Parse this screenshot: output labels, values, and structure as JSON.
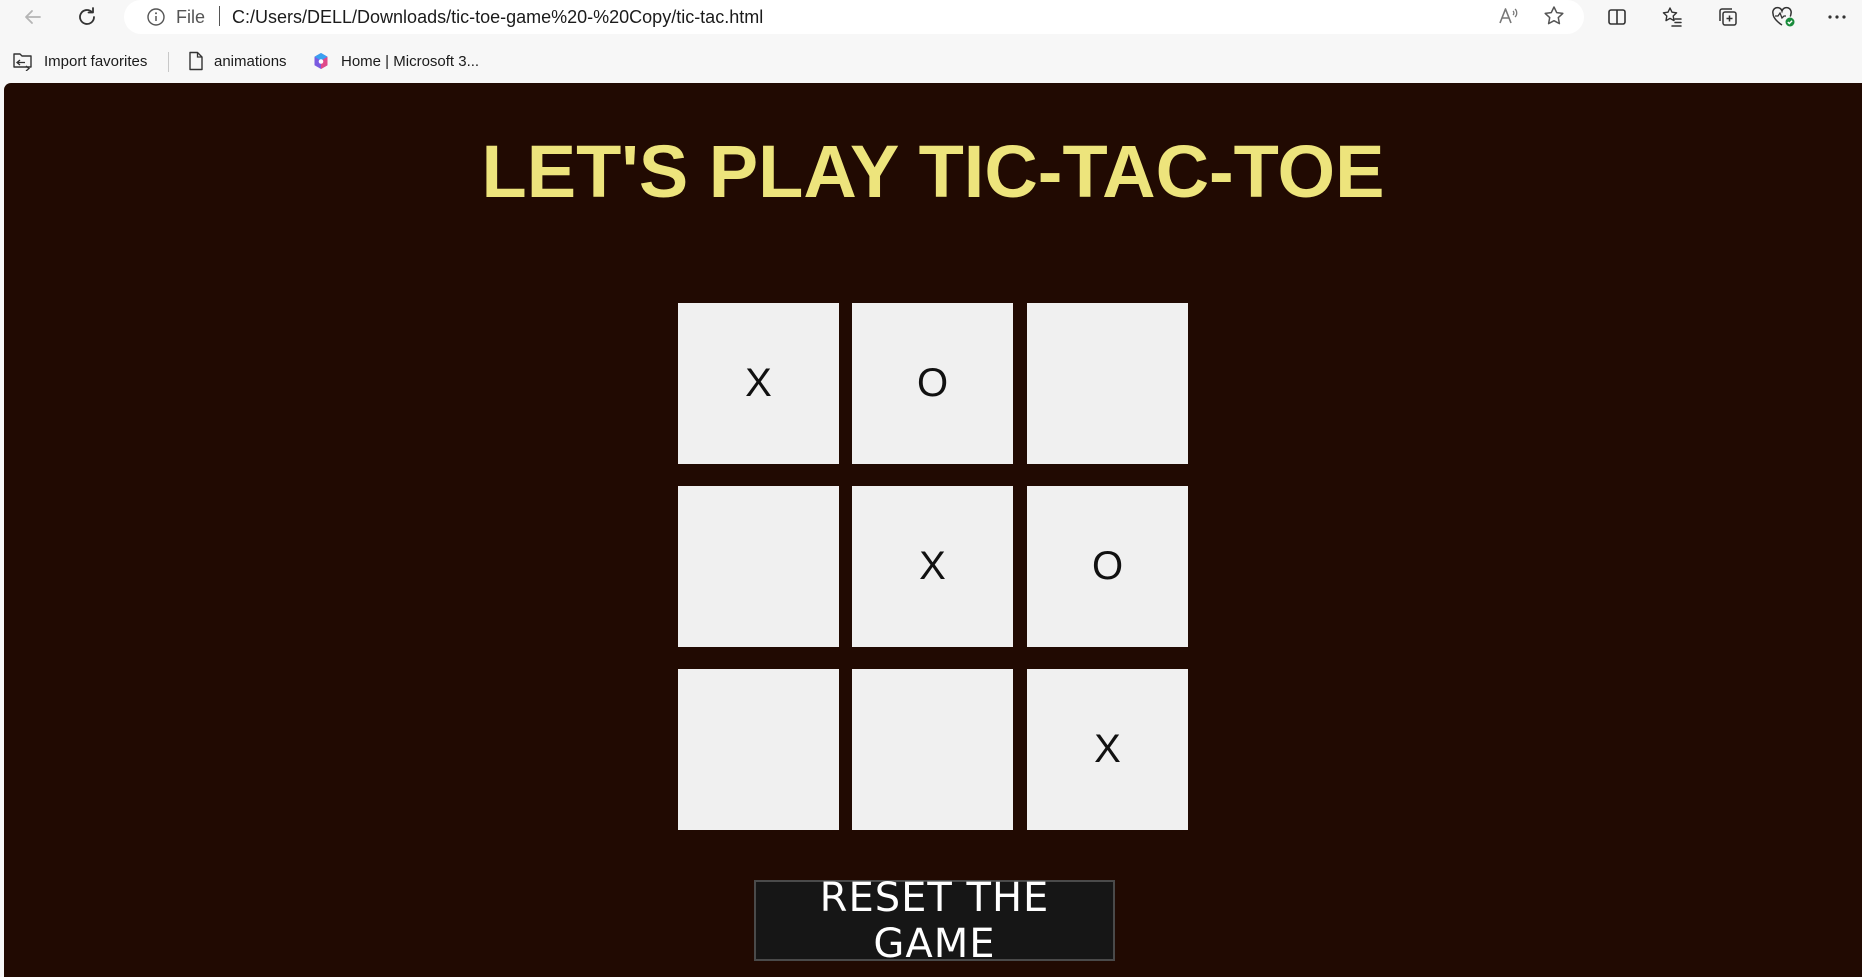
{
  "browser": {
    "address": {
      "scheme_label": "File",
      "url": "C:/Users/DELL/Downloads/tic-toe-game%20-%20Copy/tic-tac.html"
    },
    "favorites": [
      {
        "label": "Import favorites",
        "icon": "import-favorites-icon"
      },
      {
        "label": "animations",
        "icon": "page-icon"
      },
      {
        "label": "Home | Microsoft 3...",
        "icon": "microsoft365-icon"
      }
    ]
  },
  "page": {
    "title": "LET'S PLAY TIC-TAC-TOE",
    "board": [
      [
        "X",
        "O",
        ""
      ],
      [
        "",
        "X",
        "O"
      ],
      [
        "",
        "",
        "X"
      ]
    ],
    "reset_label": "RESET THE GAME"
  },
  "colors": {
    "page_background": "#210a02",
    "title": "#ede47c",
    "cell": "#f0f0f0",
    "button_background": "#161616"
  }
}
